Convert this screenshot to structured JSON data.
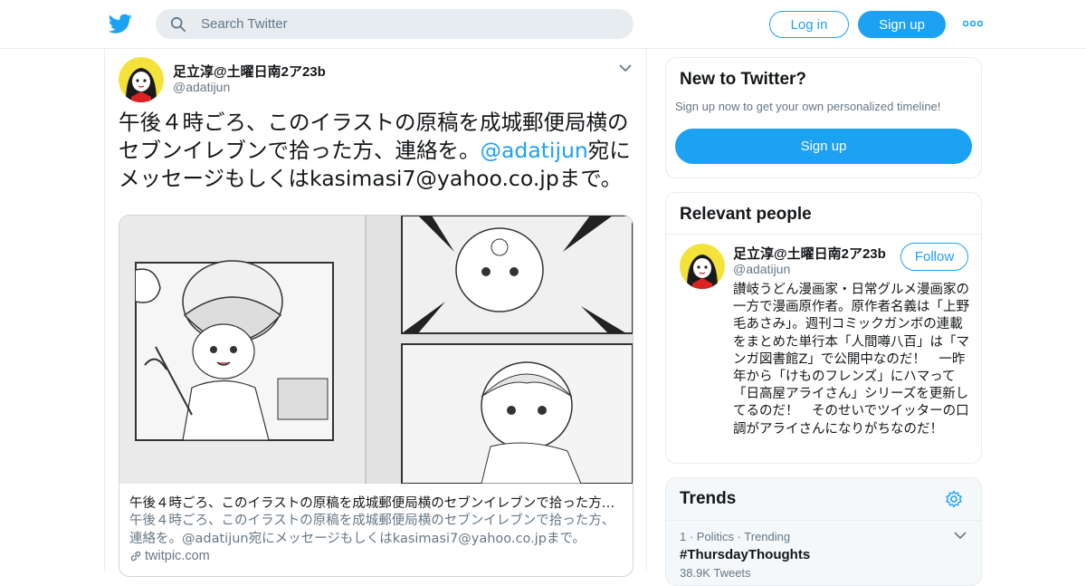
{
  "header": {
    "search_placeholder": "Search Twitter",
    "login_label": "Log in",
    "signup_label": "Sign up",
    "brand_color": "#1da1f2",
    "icons": [
      "twitter-bird-icon",
      "search-icon",
      "more-dots-icon"
    ]
  },
  "tweet": {
    "author_name": "足立淳@土曜日南2ア23b",
    "author_handle": "@adatijun",
    "text_part1": "午後４時ごろ、このイラストの原稿を成城郵便局横のセブンイレブンで拾った方、連絡を。",
    "text_mention": "@adatijun",
    "text_part2": "宛にメッセージもしくはkasimasi7@yahoo.co.jpまで。",
    "card": {
      "title": "午後４時ごろ、このイラストの原稿を成城郵便局横のセブンイレブンで拾った方、連絡を。@adatijun宛にメッセージもしくはkasimasi7@yahoo.co.jpまで。",
      "description": "午後４時ごろ、このイラストの原稿を成城郵便局横のセブンイレブンで拾った方、連絡を。@adatijun宛にメッセージもしくはkasimasi7@yahoo.co.jpまで。",
      "domain": "twitpic.com"
    }
  },
  "sidebar": {
    "new_to_twitter": {
      "title": "New to Twitter?",
      "subtitle": "Sign up now to get your own personalized timeline!",
      "signup_label": "Sign up"
    },
    "relevant_people": {
      "title": "Relevant people",
      "person": {
        "name": "足立淳@土曜日南2ア23b",
        "handle": "@adatijun",
        "follow_label": "Follow",
        "bio": "讃岐うどん漫画家・日常グルメ漫画家の一方で漫画原作者。原作者名義は「上野毛あさみ」。週刊コミックガンボの連載をまとめた単行本「人間噂八百」は「マンガ図書館Z」で公開中なのだ！　一昨年から「けものフレンズ」にハマって「日高屋アライさん」シリーズを更新してるのだ！　そのせいでツイッターの口調がアライさんになりがちなのだ！"
      }
    },
    "trends": {
      "title": "Trends",
      "items": [
        {
          "meta": "1 · Politics · Trending",
          "name": "#ThursdayThoughts",
          "count": "38.9K Tweets"
        }
      ]
    }
  }
}
